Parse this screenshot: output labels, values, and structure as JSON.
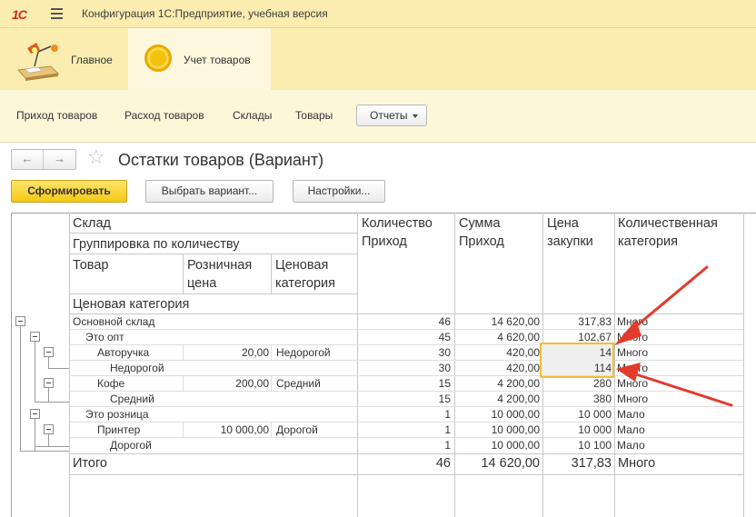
{
  "window": {
    "logo": "1С",
    "title": "Конфигурация 1С:Предприятие, учебная версия"
  },
  "sections": [
    {
      "label": "Главное",
      "icon": "desk-lamp-icon"
    },
    {
      "label": "Учет товаров",
      "icon": "coin-icon"
    }
  ],
  "commands": {
    "items": [
      "Приход товаров",
      "Расход товаров",
      "Склады",
      "Товары"
    ],
    "reports_label": "Отчеты"
  },
  "form": {
    "title": "Остатки товаров (Вариант)",
    "generate_label": "Сформировать",
    "variant_label": "Выбрать вариант...",
    "settings_label": "Настройки..."
  },
  "report": {
    "headers": {
      "warehouse": "Склад",
      "grouping": "Группировка по количеству",
      "product": "Товар",
      "retail_price_1": "Розничная",
      "retail_price_2": "цена",
      "price_category_1": "Ценовая",
      "price_category_2": "категория",
      "price_category_group": "Ценовая категория",
      "qty_in_1": "Количество",
      "qty_in_2": "Приход",
      "sum_in_1": "Сумма",
      "sum_in_2": "Приход",
      "purchase_price_1": "Цена",
      "purchase_price_2": "закупки",
      "qty_category_1": "Количественная",
      "qty_category_2": "категория"
    },
    "rows": [
      {
        "name": "Основной склад",
        "retail": "",
        "pricecat": "",
        "qty": "46",
        "sum": "14 620,00",
        "price": "317,83",
        "qtycat": "Много"
      },
      {
        "name": "Это опт",
        "retail": "",
        "pricecat": "",
        "qty": "45",
        "sum": "4 620,00",
        "price": "102,67",
        "qtycat": "Много"
      },
      {
        "name": "Авторучка",
        "retail": "20,00",
        "pricecat": "Недорогой",
        "qty": "30",
        "sum": "420,00",
        "price": "14",
        "qtycat": "Много"
      },
      {
        "name": "Недорогой",
        "retail": "",
        "pricecat": "",
        "qty": "30",
        "sum": "420,00",
        "price": "114",
        "qtycat": "Много"
      },
      {
        "name": "Кофе",
        "retail": "200,00",
        "pricecat": "Средний",
        "qty": "15",
        "sum": "4 200,00",
        "price": "280",
        "qtycat": "Много"
      },
      {
        "name": "Средний",
        "retail": "",
        "pricecat": "",
        "qty": "15",
        "sum": "4 200,00",
        "price": "380",
        "qtycat": "Много"
      },
      {
        "name": "Это розница",
        "retail": "",
        "pricecat": "",
        "qty": "1",
        "sum": "10 000,00",
        "price": "10 000",
        "qtycat": "Мало"
      },
      {
        "name": "Принтер",
        "retail": "10 000,00",
        "pricecat": "Дорогой",
        "qty": "1",
        "sum": "10 000,00",
        "price": "10 000",
        "qtycat": "Мало"
      },
      {
        "name": "Дорогой",
        "retail": "",
        "pricecat": "",
        "qty": "1",
        "sum": "10 000,00",
        "price": "10 100",
        "qtycat": "Мало"
      }
    ],
    "total": {
      "name": "Итого",
      "qty": "46",
      "sum": "14 620,00",
      "price": "317,83",
      "qtycat": "Много"
    }
  },
  "colors": {
    "panel_yellow": "#fbedb0",
    "primary_button": "#f5c913",
    "highlight_border": "#f2bf2c",
    "annotation_arrow": "#e23b2e"
  }
}
